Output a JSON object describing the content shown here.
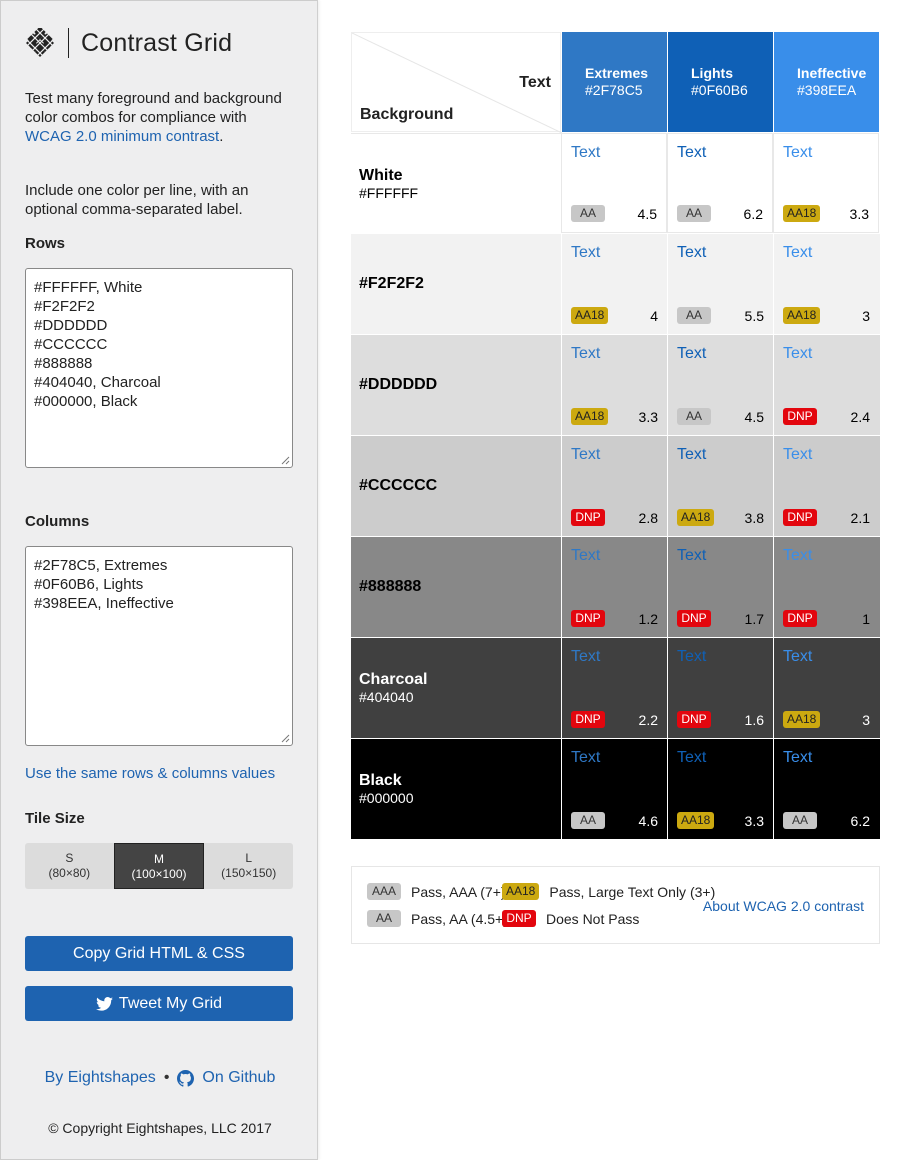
{
  "app": {
    "title": "Contrast Grid",
    "intro_prefix": "Test many foreground and background color combos for compliance with ",
    "intro_link": "WCAG 2.0 minimum contrast",
    "intro_suffix": ".",
    "intro2": "Include one color per line, with an optional comma-separated label."
  },
  "rows_input": {
    "label": "Rows",
    "value": "#FFFFFF, White\n#F2F2F2\n#DDDDDD\n#CCCCCC\n#888888\n#404040, Charcoal\n#000000, Black"
  },
  "columns_input": {
    "label": "Columns",
    "value": "#2F78C5, Extremes\n#0F60B6, Lights\n#398EEA, Ineffective"
  },
  "same_values_link": "Use the same rows & columns values",
  "tile_size": {
    "label": "Tile Size",
    "options": [
      {
        "name": "S",
        "dims": "(80×80)",
        "selected": false
      },
      {
        "name": "M",
        "dims": "(100×100)",
        "selected": true
      },
      {
        "name": "L",
        "dims": "(150×150)",
        "selected": false
      }
    ]
  },
  "buttons": {
    "copy": "Copy Grid HTML & CSS",
    "tweet": "Tweet My Grid"
  },
  "footer": {
    "by": "By Eightshapes",
    "github": "On Github",
    "copyright": "© Copyright Eightshapes, LLC 2017"
  },
  "grid": {
    "corner_text": "Text",
    "corner_bg": "Background",
    "sample_text": "Text",
    "columns": [
      {
        "name": "Extremes",
        "hex": "#2F78C5"
      },
      {
        "name": "Lights",
        "hex": "#0F60B6"
      },
      {
        "name": "Ineffective",
        "hex": "#398EEA"
      }
    ],
    "rows": [
      {
        "name": "White",
        "hex": "#FFFFFF",
        "fg": "#000000",
        "cells": [
          {
            "badge": "AA",
            "ratio": "4.5"
          },
          {
            "badge": "AA",
            "ratio": "6.2"
          },
          {
            "badge": "AA18",
            "ratio": "3.3"
          }
        ]
      },
      {
        "name": "",
        "hex": "#F2F2F2",
        "fg": "#000000",
        "cells": [
          {
            "badge": "AA18",
            "ratio": "4"
          },
          {
            "badge": "AA",
            "ratio": "5.5"
          },
          {
            "badge": "AA18",
            "ratio": "3"
          }
        ]
      },
      {
        "name": "",
        "hex": "#DDDDDD",
        "fg": "#000000",
        "cells": [
          {
            "badge": "AA18",
            "ratio": "3.3"
          },
          {
            "badge": "AA",
            "ratio": "4.5"
          },
          {
            "badge": "DNP",
            "ratio": "2.4"
          }
        ]
      },
      {
        "name": "",
        "hex": "#CCCCCC",
        "fg": "#000000",
        "cells": [
          {
            "badge": "DNP",
            "ratio": "2.8"
          },
          {
            "badge": "AA18",
            "ratio": "3.8"
          },
          {
            "badge": "DNP",
            "ratio": "2.1"
          }
        ]
      },
      {
        "name": "",
        "hex": "#888888",
        "fg": "#000000",
        "cells": [
          {
            "badge": "DNP",
            "ratio": "1.2"
          },
          {
            "badge": "DNP",
            "ratio": "1.7"
          },
          {
            "badge": "DNP",
            "ratio": "1"
          }
        ]
      },
      {
        "name": "Charcoal",
        "hex": "#404040",
        "fg": "#FFFFFF",
        "cells": [
          {
            "badge": "DNP",
            "ratio": "2.2"
          },
          {
            "badge": "DNP",
            "ratio": "1.6"
          },
          {
            "badge": "AA18",
            "ratio": "3"
          }
        ]
      },
      {
        "name": "Black",
        "hex": "#000000",
        "fg": "#FFFFFF",
        "cells": [
          {
            "badge": "AA",
            "ratio": "4.6"
          },
          {
            "badge": "AA18",
            "ratio": "3.3"
          },
          {
            "badge": "AA",
            "ratio": "6.2"
          }
        ]
      }
    ]
  },
  "legend": {
    "items": [
      {
        "badge": "AAA",
        "text": "Pass, AAA (7+)"
      },
      {
        "badge": "AA18",
        "text": "Pass, Large Text Only (3+)"
      },
      {
        "badge": "AA",
        "text": "Pass, AA (4.5+)"
      },
      {
        "badge": "DNP",
        "text": "Does Not Pass"
      }
    ],
    "about": "About WCAG 2.0 contrast"
  },
  "colors": {
    "accent": "#1E63B0",
    "badge_aa": "#C7C7C7",
    "badge_aa18": "#CCA910",
    "badge_dnp": "#E3060E",
    "header_extremes": "#2F78C5",
    "header_lights": "#0F60B6",
    "header_ineffective": "#398EEA"
  },
  "icons": [
    "logo-icon",
    "twitter-icon",
    "github-icon"
  ]
}
